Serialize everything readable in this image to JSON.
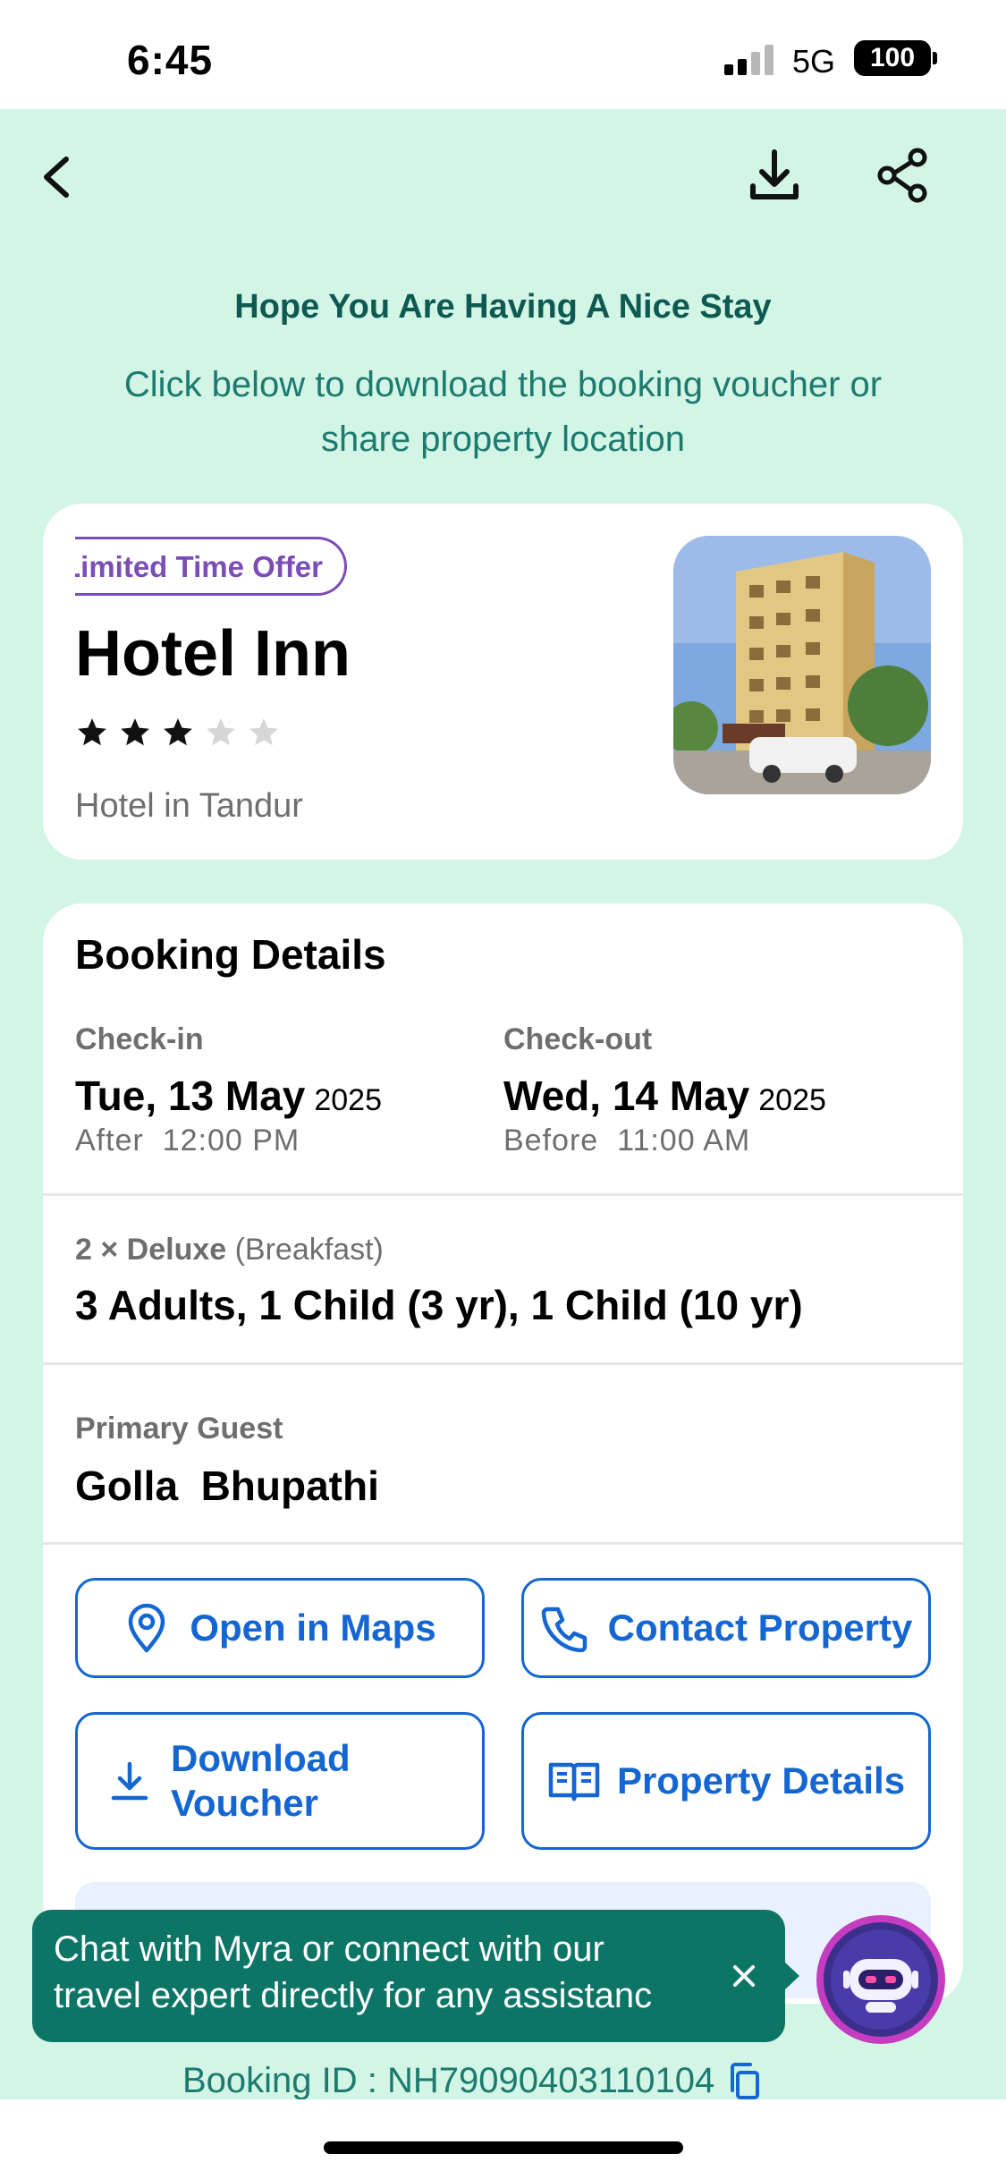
{
  "status_bar": {
    "time": "6:45",
    "network": "5G",
    "battery": "100"
  },
  "header": {
    "back_icon": "chevron-left-icon",
    "download_icon": "download-icon",
    "share_icon": "share-icon"
  },
  "banner": {
    "title": "Hope You Are Having A Nice Stay",
    "subtitle_line1": "Click below to download the booking voucher or",
    "subtitle_line2": "share property location"
  },
  "hotel": {
    "offer_badge": "Limited Time Offer",
    "name": "Hotel Inn",
    "star_rating": 3,
    "star_max": 5,
    "location": "Hotel in Tandur"
  },
  "booking": {
    "title": "Booking Details",
    "checkin": {
      "label": "Check-in",
      "date": "Tue, 13 May",
      "year": "2025",
      "note": "After  12:00 PM"
    },
    "checkout": {
      "label": "Check-out",
      "date": "Wed, 14 May",
      "year": "2025",
      "note": "Before  11:00 AM"
    },
    "room_type": "2 × Deluxe",
    "meal_plan": "(Breakfast)",
    "guests": "3 Adults, 1 Child (3 yr), 1 Child (10 yr)",
    "primary_guest_label": "Primary Guest",
    "primary_guest_name": "Golla  Bhupathi"
  },
  "actions": {
    "open_maps": "Open in Maps",
    "contact_property": "Contact Property",
    "download_voucher_line1": "Download",
    "download_voucher_line2": "Voucher",
    "property_details": "Property Details"
  },
  "chat_toast": {
    "line1": "Chat with Myra or connect with our",
    "line2": "travel expert directly for any assistanc"
  },
  "footer": {
    "booking_id": "Booking ID : NH79090403110104"
  },
  "colors": {
    "background_green": "#d2f5e6",
    "accent_blue": "#1466d2",
    "teal_dark": "#0e5a52",
    "toast_teal": "#0d7566",
    "offer_purple": "#7b4db6"
  }
}
